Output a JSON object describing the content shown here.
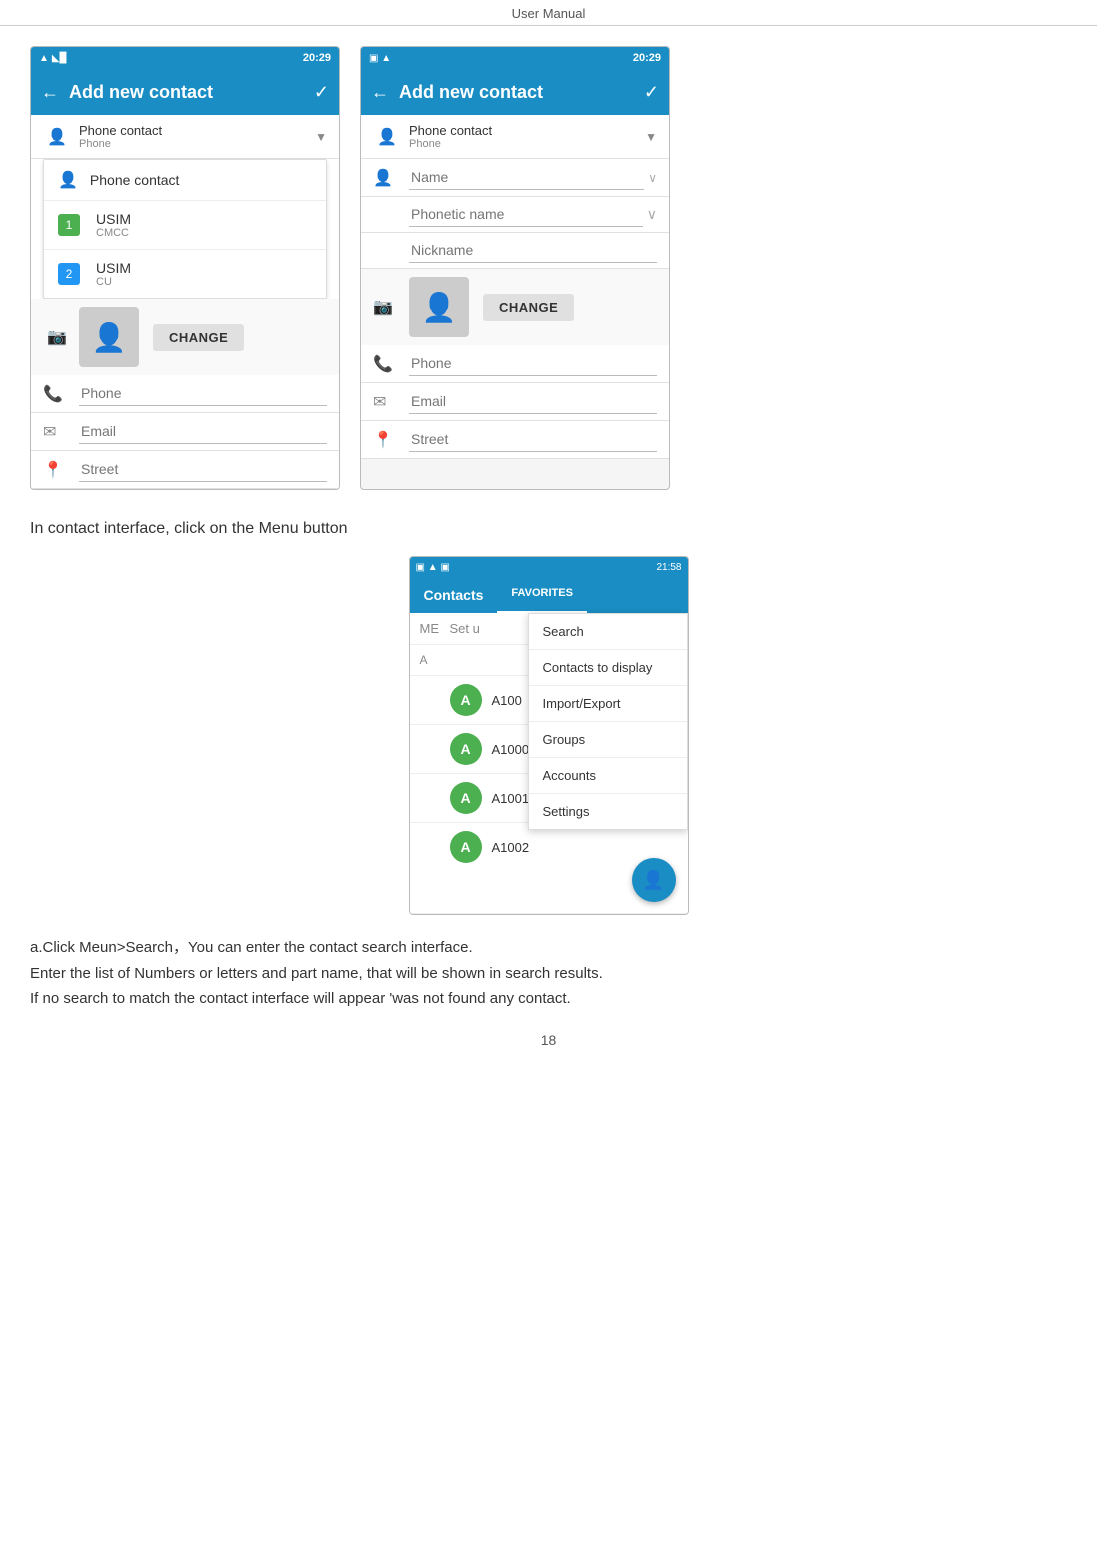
{
  "header": {
    "title": "User    Manual"
  },
  "left_phone": {
    "status_bar": {
      "wifi": "▲◣",
      "signal": "▲◣▉",
      "time": "20:29"
    },
    "app_bar": {
      "back": "←",
      "title": "Add new contact",
      "check": "✓"
    },
    "contact_type_label": "Phone contact",
    "contact_type_sub": "Phone",
    "dropdown_items": [
      {
        "icon": "👤",
        "label": "Phone contact"
      },
      {
        "icon": "1",
        "label": "USIM",
        "sub": "CMCC"
      },
      {
        "icon": "2",
        "label": "USIM",
        "sub": "CU"
      }
    ],
    "change_label": "CHANGE",
    "phone_placeholder": "Phone",
    "email_placeholder": "Email",
    "street_placeholder": "Street"
  },
  "right_phone": {
    "status_bar": {
      "icons_left": "▣ ▲",
      "signal": "▲◣▉",
      "time": "20:29"
    },
    "app_bar": {
      "back": "←",
      "title": "Add new contact",
      "check": "✓"
    },
    "contact_type_label": "Phone contact",
    "contact_type_sub": "Phone",
    "name_placeholder": "Name",
    "phonetic_name_placeholder": "Phonetic name",
    "nickname_placeholder": "Nickname",
    "change_label": "CHANGE",
    "phone_placeholder": "Phone",
    "email_placeholder": "Email",
    "street_placeholder": "Street"
  },
  "instruction": {
    "text": "In contact    interface, click on the Menu button"
  },
  "contacts_screen": {
    "status_bar": {
      "icons_left": "▣ ▲ ▣",
      "signal": "▲◣▉",
      "time": "21:58"
    },
    "contacts_tab": "Contacts",
    "favorites_tab": "FAVORITES",
    "me_label": "ME",
    "set_label": "Set u",
    "section_a": "A",
    "context_menu_items": [
      "Search",
      "Contacts to display",
      "Import/Export",
      "Groups",
      "Accounts",
      "Settings"
    ],
    "contacts_list": [
      {
        "avatar_letter": "A",
        "name": "A100"
      },
      {
        "avatar_letter": "A",
        "name": "A1000"
      },
      {
        "avatar_letter": "A",
        "name": "A1001"
      },
      {
        "avatar_letter": "A",
        "name": "A1002"
      }
    ],
    "fab_icon": "👤+"
  },
  "bottom_text": {
    "line1": "a.Click Meun>Search，You can enter the contact search interface.",
    "line2": "Enter the list of Numbers or letters and part name, that will be shown in search results.",
    "line3": "If no search to match the contact interface will appear 'was not found any contact."
  },
  "page_number": "18"
}
